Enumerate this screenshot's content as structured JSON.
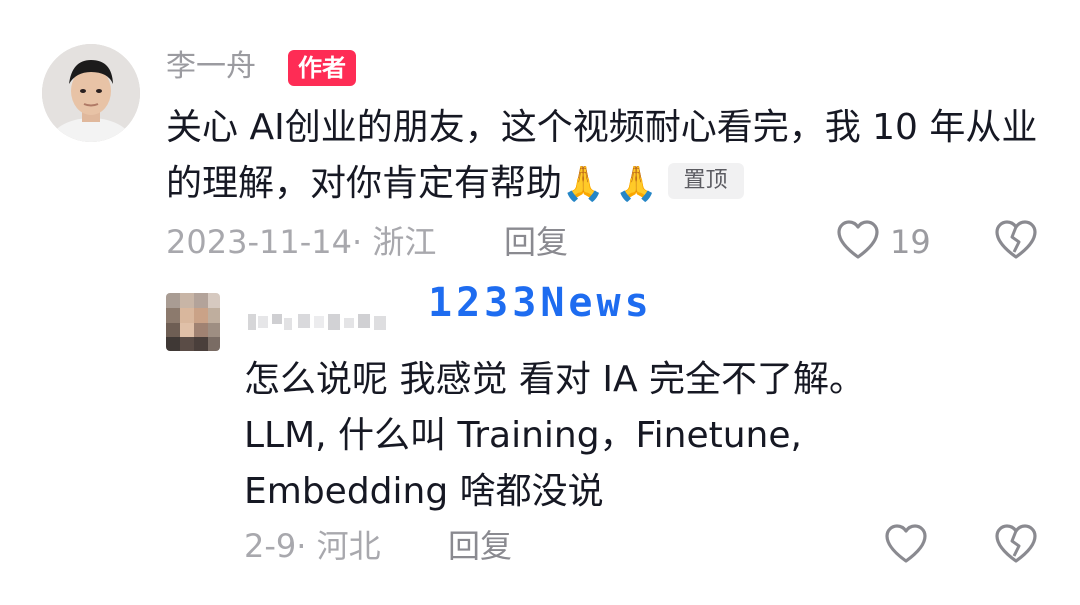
{
  "comment": {
    "author": "李一舟",
    "author_badge": "作者",
    "text": "关心 AI创业的朋友，这个视频耐心看完，我 10 年从业的理解，对你肯定有帮助",
    "emojis": "🙏 🙏",
    "pin_label": "置顶",
    "meta": "2023-11-14· 浙江",
    "reply_label": "回复",
    "like_count": "19"
  },
  "reply": {
    "text_line1": "怎么说呢 我感觉 看对 IA 完全不了解。",
    "text_line2": "LLM, 什么叫 Training，Finetune,",
    "text_line3": "Embedding 啥都没说",
    "meta": "2-9· 河北",
    "reply_label": "回复"
  },
  "watermark": "1233News",
  "colors": {
    "badge_red": "#fe2c55",
    "watermark_blue": "#1e6cf0",
    "muted_text": "#a8a8ad"
  }
}
